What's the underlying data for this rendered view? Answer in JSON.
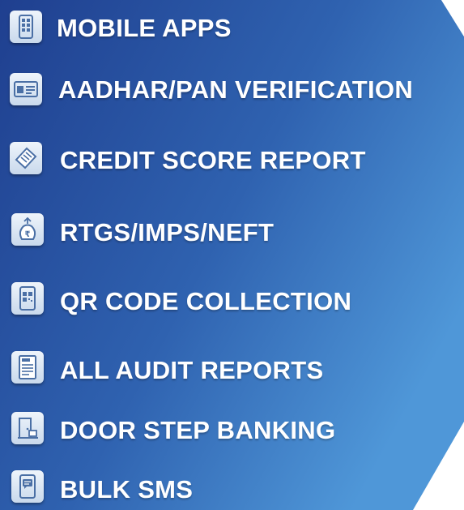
{
  "colors": {
    "panel_dark": "#1f3f8f",
    "panel_light": "#4f97d8",
    "label": "#ffffff",
    "icon_bg": "#dce7f4",
    "icon_stroke": "#4a6fa5"
  },
  "services": [
    {
      "label": "MOBILE APPS",
      "icon": "mobile-app-icon"
    },
    {
      "label": "AADHAR/PAN VERIFICATION",
      "icon": "id-card-icon"
    },
    {
      "label": "CREDIT SCORE REPORT",
      "icon": "report-slip-icon"
    },
    {
      "label": "RTGS/IMPS/NEFT",
      "icon": "money-bag-transfer-icon"
    },
    {
      "label": "QR CODE COLLECTION",
      "icon": "qr-code-icon"
    },
    {
      "label": "ALL AUDIT REPORTS",
      "icon": "audit-document-icon"
    },
    {
      "label": "DOOR STEP BANKING",
      "icon": "door-delivery-icon"
    },
    {
      "label": "BULK SMS",
      "icon": "sms-phone-icon"
    }
  ]
}
